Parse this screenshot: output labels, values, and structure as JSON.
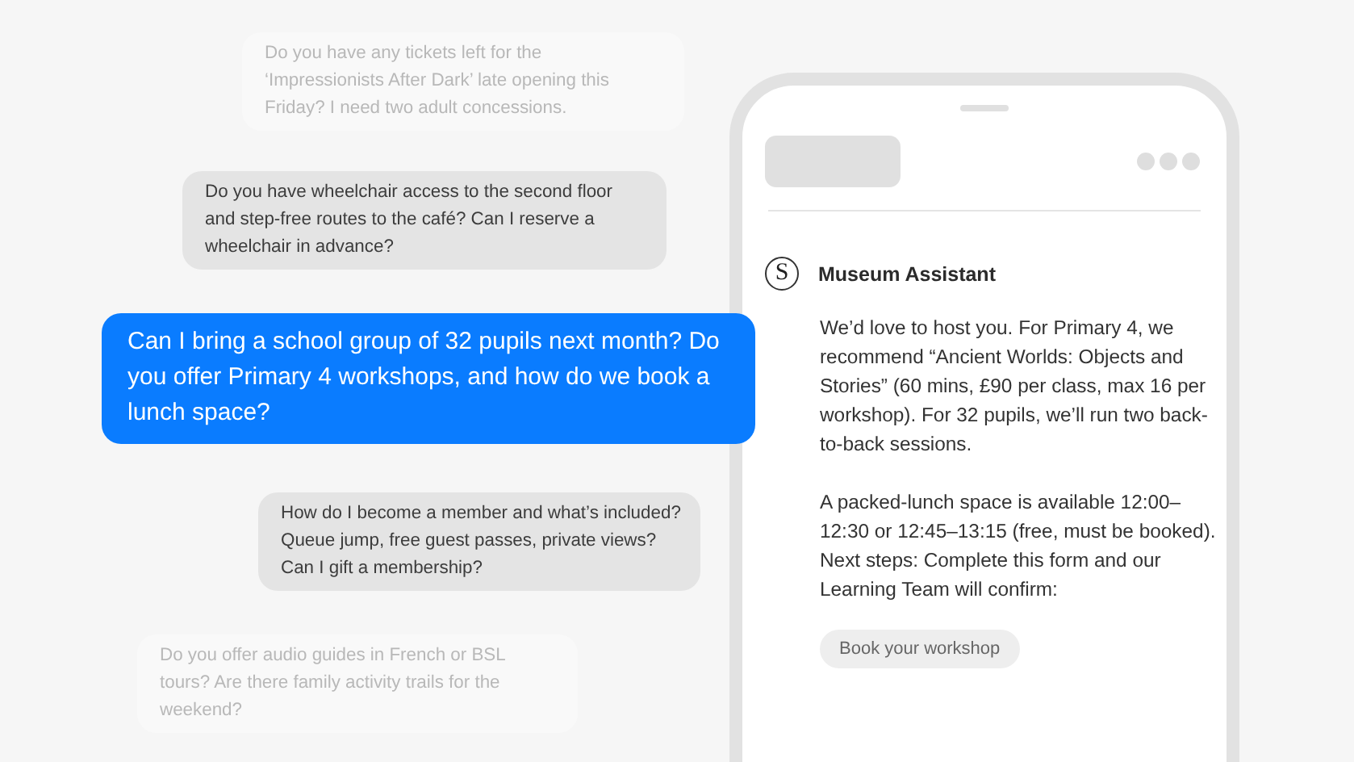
{
  "messages": [
    {
      "kind": "faded",
      "text": "Do you have any tickets left for the ‘Impressionists After Dark’ late opening this Friday? I need two adult concessions."
    },
    {
      "kind": "muted",
      "text": "Do you have wheelchair access to the second floor and step-free routes to the café? Can I reserve a wheelchair in advance?"
    },
    {
      "kind": "active",
      "text": "Can I bring a school group of 32 pupils next month? Do you offer Primary 4 workshops, and how do we book a lunch space?"
    },
    {
      "kind": "muted",
      "text": "How do I become a member and what’s included? Queue jump, free guest passes, private views? Can I gift a membership?"
    },
    {
      "kind": "faded",
      "text": "Do you offer audio guides in French or BSL tours? Are there family activity trails for the weekend?"
    }
  ],
  "phone": {
    "assistant": {
      "icon_letter": "S",
      "name": "Museum Assistant"
    },
    "paragraphs": [
      "We’d love to host you. For Primary 4, we recommend “Ancient Worlds: Objects and Stories” (60 mins, £90 per class, max 16 per workshop). For 32 pupils, we’ll run two back-to-back sessions.",
      "A packed-lunch space is available 12:00–12:30 or 12:45–13:15 (free, must be booked). Next steps: Complete this form and our Learning Team will confirm:"
    ],
    "button": "Book your workshop"
  }
}
